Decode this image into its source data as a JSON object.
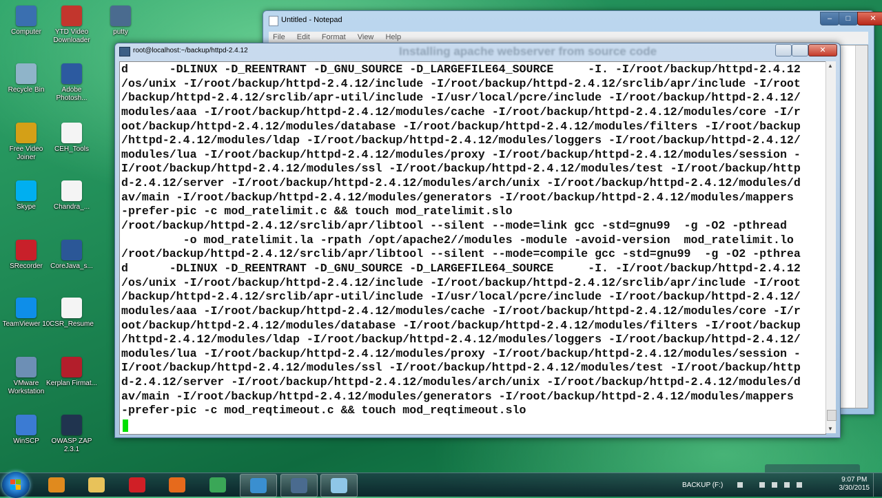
{
  "desktop": {
    "icons": [
      {
        "label": "Computer",
        "icon": "computer-icon",
        "color": "#3a6fb0"
      },
      {
        "label": "YTD Video Downloader",
        "icon": "ytd-icon",
        "color": "#c2362d"
      },
      {
        "label": "putty",
        "icon": "putty-icon",
        "color": "#4a6b8f"
      },
      {
        "label": "Recycle Bin",
        "icon": "recycle-bin-icon",
        "color": "#8fb4c9"
      },
      {
        "label": "Adobe Photosh...",
        "icon": "photoshop-icon",
        "color": "#2c5aa0"
      },
      {
        "label": "Free Video Joiner",
        "icon": "video-joiner-icon",
        "color": "#d4a017"
      },
      {
        "label": "CEH_Tools",
        "icon": "document-icon",
        "color": "#f4f4f4"
      },
      {
        "label": "Skype",
        "icon": "skype-icon",
        "color": "#00aff0"
      },
      {
        "label": "Chandra_...",
        "icon": "document-icon",
        "color": "#f4f4f4"
      },
      {
        "label": "SRecorder",
        "icon": "srecorder-icon",
        "color": "#c8202a"
      },
      {
        "label": "CoreJava_s...",
        "icon": "word-doc-icon",
        "color": "#2b5797"
      },
      {
        "label": "TeamViewer 10",
        "icon": "teamviewer-icon",
        "color": "#0e8ee9"
      },
      {
        "label": "CSR_Resume",
        "icon": "document-icon",
        "color": "#f4f4f4"
      },
      {
        "label": "VMware Workstation",
        "icon": "vmware-icon",
        "color": "#6d8fb5"
      },
      {
        "label": "Kerplan Firmat...",
        "icon": "app-icon",
        "color": "#b31e2b"
      },
      {
        "label": "WinSCP",
        "icon": "winscp-icon",
        "color": "#3b7bd3"
      },
      {
        "label": "OWASP ZAP 2.3.1",
        "icon": "zap-icon",
        "color": "#20344f"
      }
    ]
  },
  "notepad": {
    "title": "Untitled - Notepad",
    "menu": [
      "File",
      "Edit",
      "Format",
      "View",
      "Help"
    ],
    "controls": {
      "minimize": "–",
      "maximize": "□",
      "close": "✕"
    }
  },
  "terminal": {
    "title": "root@localhost:~/backup/httpd-2.4.12",
    "overlay_caption": "Installing apache webserver from source code",
    "lines": [
      "d      -DLINUX -D_REENTRANT -D_GNU_SOURCE -D_LARGEFILE64_SOURCE     -I. -I/root/backup/httpd-2.4.12",
      "/os/unix -I/root/backup/httpd-2.4.12/include -I/root/backup/httpd-2.4.12/srclib/apr/include -I/root",
      "/backup/httpd-2.4.12/srclib/apr-util/include -I/usr/local/pcre/include -I/root/backup/httpd-2.4.12/",
      "modules/aaa -I/root/backup/httpd-2.4.12/modules/cache -I/root/backup/httpd-2.4.12/modules/core -I/r",
      "oot/backup/httpd-2.4.12/modules/database -I/root/backup/httpd-2.4.12/modules/filters -I/root/backup",
      "/httpd-2.4.12/modules/ldap -I/root/backup/httpd-2.4.12/modules/loggers -I/root/backup/httpd-2.4.12/",
      "modules/lua -I/root/backup/httpd-2.4.12/modules/proxy -I/root/backup/httpd-2.4.12/modules/session -",
      "I/root/backup/httpd-2.4.12/modules/ssl -I/root/backup/httpd-2.4.12/modules/test -I/root/backup/http",
      "d-2.4.12/server -I/root/backup/httpd-2.4.12/modules/arch/unix -I/root/backup/httpd-2.4.12/modules/d",
      "av/main -I/root/backup/httpd-2.4.12/modules/generators -I/root/backup/httpd-2.4.12/modules/mappers",
      "-prefer-pic -c mod_ratelimit.c && touch mod_ratelimit.slo",
      "/root/backup/httpd-2.4.12/srclib/apr/libtool --silent --mode=link gcc -std=gnu99  -g -O2 -pthread",
      "         -o mod_ratelimit.la -rpath /opt/apache2//modules -module -avoid-version  mod_ratelimit.lo",
      "/root/backup/httpd-2.4.12/srclib/apr/libtool --silent --mode=compile gcc -std=gnu99  -g -O2 -pthrea",
      "d      -DLINUX -D_REENTRANT -D_GNU_SOURCE -D_LARGEFILE64_SOURCE     -I. -I/root/backup/httpd-2.4.12",
      "/os/unix -I/root/backup/httpd-2.4.12/include -I/root/backup/httpd-2.4.12/srclib/apr/include -I/root",
      "/backup/httpd-2.4.12/srclib/apr-util/include -I/usr/local/pcre/include -I/root/backup/httpd-2.4.12/",
      "modules/aaa -I/root/backup/httpd-2.4.12/modules/cache -I/root/backup/httpd-2.4.12/modules/core -I/r",
      "oot/backup/httpd-2.4.12/modules/database -I/root/backup/httpd-2.4.12/modules/filters -I/root/backup",
      "/httpd-2.4.12/modules/ldap -I/root/backup/httpd-2.4.12/modules/loggers -I/root/backup/httpd-2.4.12/",
      "modules/lua -I/root/backup/httpd-2.4.12/modules/proxy -I/root/backup/httpd-2.4.12/modules/session -",
      "I/root/backup/httpd-2.4.12/modules/ssl -I/root/backup/httpd-2.4.12/modules/test -I/root/backup/http",
      "d-2.4.12/server -I/root/backup/httpd-2.4.12/modules/arch/unix -I/root/backup/httpd-2.4.12/modules/d",
      "av/main -I/root/backup/httpd-2.4.12/modules/generators -I/root/backup/httpd-2.4.12/modules/mappers",
      "-prefer-pic -c mod_reqtimeout.c && touch mod_reqtimeout.slo"
    ],
    "cursor_color": "#00e000"
  },
  "taskbar": {
    "items": [
      {
        "name": "media-player-icon",
        "color": "#e08a1e",
        "active": false
      },
      {
        "name": "file-explorer-icon",
        "color": "#e8c25a",
        "active": false
      },
      {
        "name": "opera-icon",
        "color": "#d01f26",
        "active": false
      },
      {
        "name": "firefox-icon",
        "color": "#e66a1c",
        "active": false
      },
      {
        "name": "chrome-icon",
        "color": "#3aa757",
        "active": false
      },
      {
        "name": "camtasia-icon",
        "color": "#3a8fd0",
        "active": true
      },
      {
        "name": "putty-icon",
        "color": "#4a6b8f",
        "active": true
      },
      {
        "name": "notepad-icon",
        "color": "#8fc7e8",
        "active": true
      }
    ],
    "tray": {
      "drive_label": "BACKUP (F:)",
      "time": "9:07 PM",
      "date": "3/30/2015"
    }
  }
}
